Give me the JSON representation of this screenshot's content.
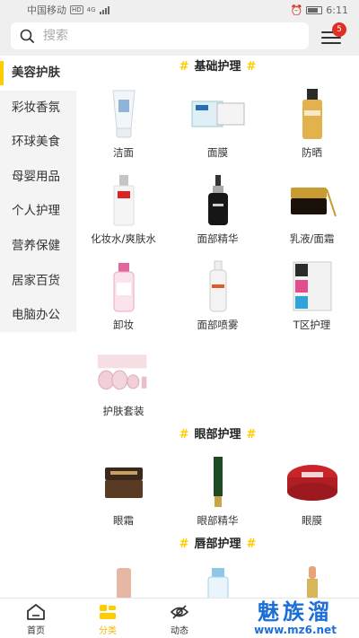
{
  "status_bar": {
    "carrier": "中国移动",
    "network_tag": "HD",
    "network_type": "4G",
    "time": "6:11",
    "icons": [
      "signal-icon",
      "alarm-icon",
      "battery-icon"
    ]
  },
  "search": {
    "placeholder": "搜索",
    "icon": "search-icon"
  },
  "menu": {
    "icon": "menu-icon",
    "badge_count": "5"
  },
  "sidebar": {
    "items": [
      {
        "label": "美容护肤",
        "active": true
      },
      {
        "label": "彩妆香氛",
        "active": false
      },
      {
        "label": "环球美食",
        "active": false
      },
      {
        "label": "母婴用品",
        "active": false
      },
      {
        "label": "个人护理",
        "active": false
      },
      {
        "label": "营养保健",
        "active": false
      },
      {
        "label": "居家百货",
        "active": false
      },
      {
        "label": "电脑办公",
        "active": false
      }
    ]
  },
  "sections": [
    {
      "title": "基础护理",
      "items": [
        {
          "label": "洁面",
          "icon": "cleanser-tube-icon"
        },
        {
          "label": "面膜",
          "icon": "face-mask-box-icon"
        },
        {
          "label": "防晒",
          "icon": "sunscreen-bottle-icon"
        },
        {
          "label": "化妆水/爽肤水",
          "icon": "toner-bottle-icon"
        },
        {
          "label": "面部精华",
          "icon": "serum-bottle-icon"
        },
        {
          "label": "乳液/面霜",
          "icon": "cream-jar-icon"
        },
        {
          "label": "卸妆",
          "icon": "makeup-remover-bottle-icon"
        },
        {
          "label": "面部喷雾",
          "icon": "spray-bottle-icon"
        },
        {
          "label": "T区护理",
          "icon": "nose-strip-pack-icon"
        },
        {
          "label": "护肤套装",
          "icon": "skincare-set-icon"
        }
      ]
    },
    {
      "title": "眼部护理",
      "items": [
        {
          "label": "眼霜",
          "icon": "eye-cream-jar-icon"
        },
        {
          "label": "眼部精华",
          "icon": "eye-serum-tube-icon"
        },
        {
          "label": "眼膜",
          "icon": "eye-mask-tin-icon"
        }
      ]
    },
    {
      "title": "唇部护理",
      "items": [
        {
          "label": "",
          "icon": "lip-tube-icon"
        },
        {
          "label": "",
          "icon": "lip-bottle-icon"
        },
        {
          "label": "",
          "icon": "lip-balm-stick-icon"
        }
      ]
    }
  ],
  "bottom_nav": {
    "items": [
      {
        "label": "首页",
        "icon": "home-icon",
        "active": false
      },
      {
        "label": "分类",
        "icon": "category-icon",
        "active": true
      },
      {
        "label": "动态",
        "icon": "eye-slash-icon",
        "active": false
      }
    ]
  },
  "watermark": {
    "title": "魅族溜",
    "url": "www.mz6.net"
  },
  "colors": {
    "accent": "#ffcc00",
    "badge": "#e02e24",
    "watermark": "#1d6fd8",
    "background": "#efefef"
  }
}
